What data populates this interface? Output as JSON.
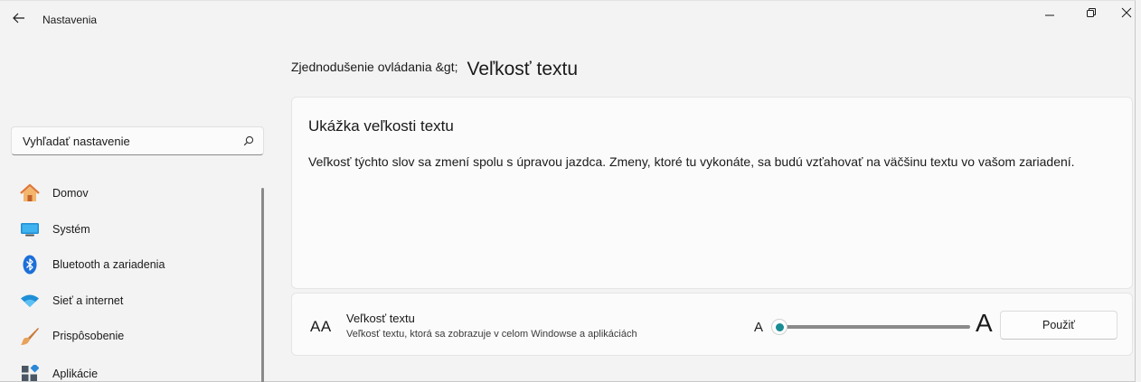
{
  "window": {
    "title": "Nastavenia",
    "controls": {
      "minimize_icon": "minimize-icon",
      "restore_icon": "restore-icon",
      "close_icon": "close-icon"
    }
  },
  "sidebar": {
    "search": {
      "placeholder": "Vyhľadať nastavenie",
      "value": "Vyhľadať nastavenie"
    },
    "items": [
      {
        "label": "Domov",
        "icon": "home-icon"
      },
      {
        "label": "Systém",
        "icon": "system-icon"
      },
      {
        "label": "Bluetooth a zariadenia",
        "icon": "bluetooth-icon"
      },
      {
        "label": "Sieť a internet",
        "icon": "wifi-icon"
      },
      {
        "label": "Prispôsobenie",
        "icon": "brush-icon"
      },
      {
        "label": "Aplikácie",
        "icon": "apps-icon"
      }
    ]
  },
  "breadcrumb": {
    "parent": "Zjednodušenie ovládania &gt;",
    "current": "Veľkosť textu"
  },
  "preview": {
    "title": "Ukážka veľkosti textu",
    "text": "Veľkosť týchto slov sa zmení spolu s úpravou jazdca. Zmeny, ktoré tu vykonáte, sa budú vzťahovať na väčšinu textu vo vašom zariadení."
  },
  "text_size": {
    "icon_text": "AA",
    "title": "Veľkosť textu",
    "description": "Veľkosť textu, ktorá sa zobrazuje v celom Windowse a aplikáciách",
    "small_label": "A",
    "large_label": "A",
    "slider_level": 0.0,
    "apply_label": "Použiť"
  },
  "colors": {
    "accent": "#1a8c94",
    "background": "#f3f3f3",
    "card": "#fbfbfb"
  }
}
